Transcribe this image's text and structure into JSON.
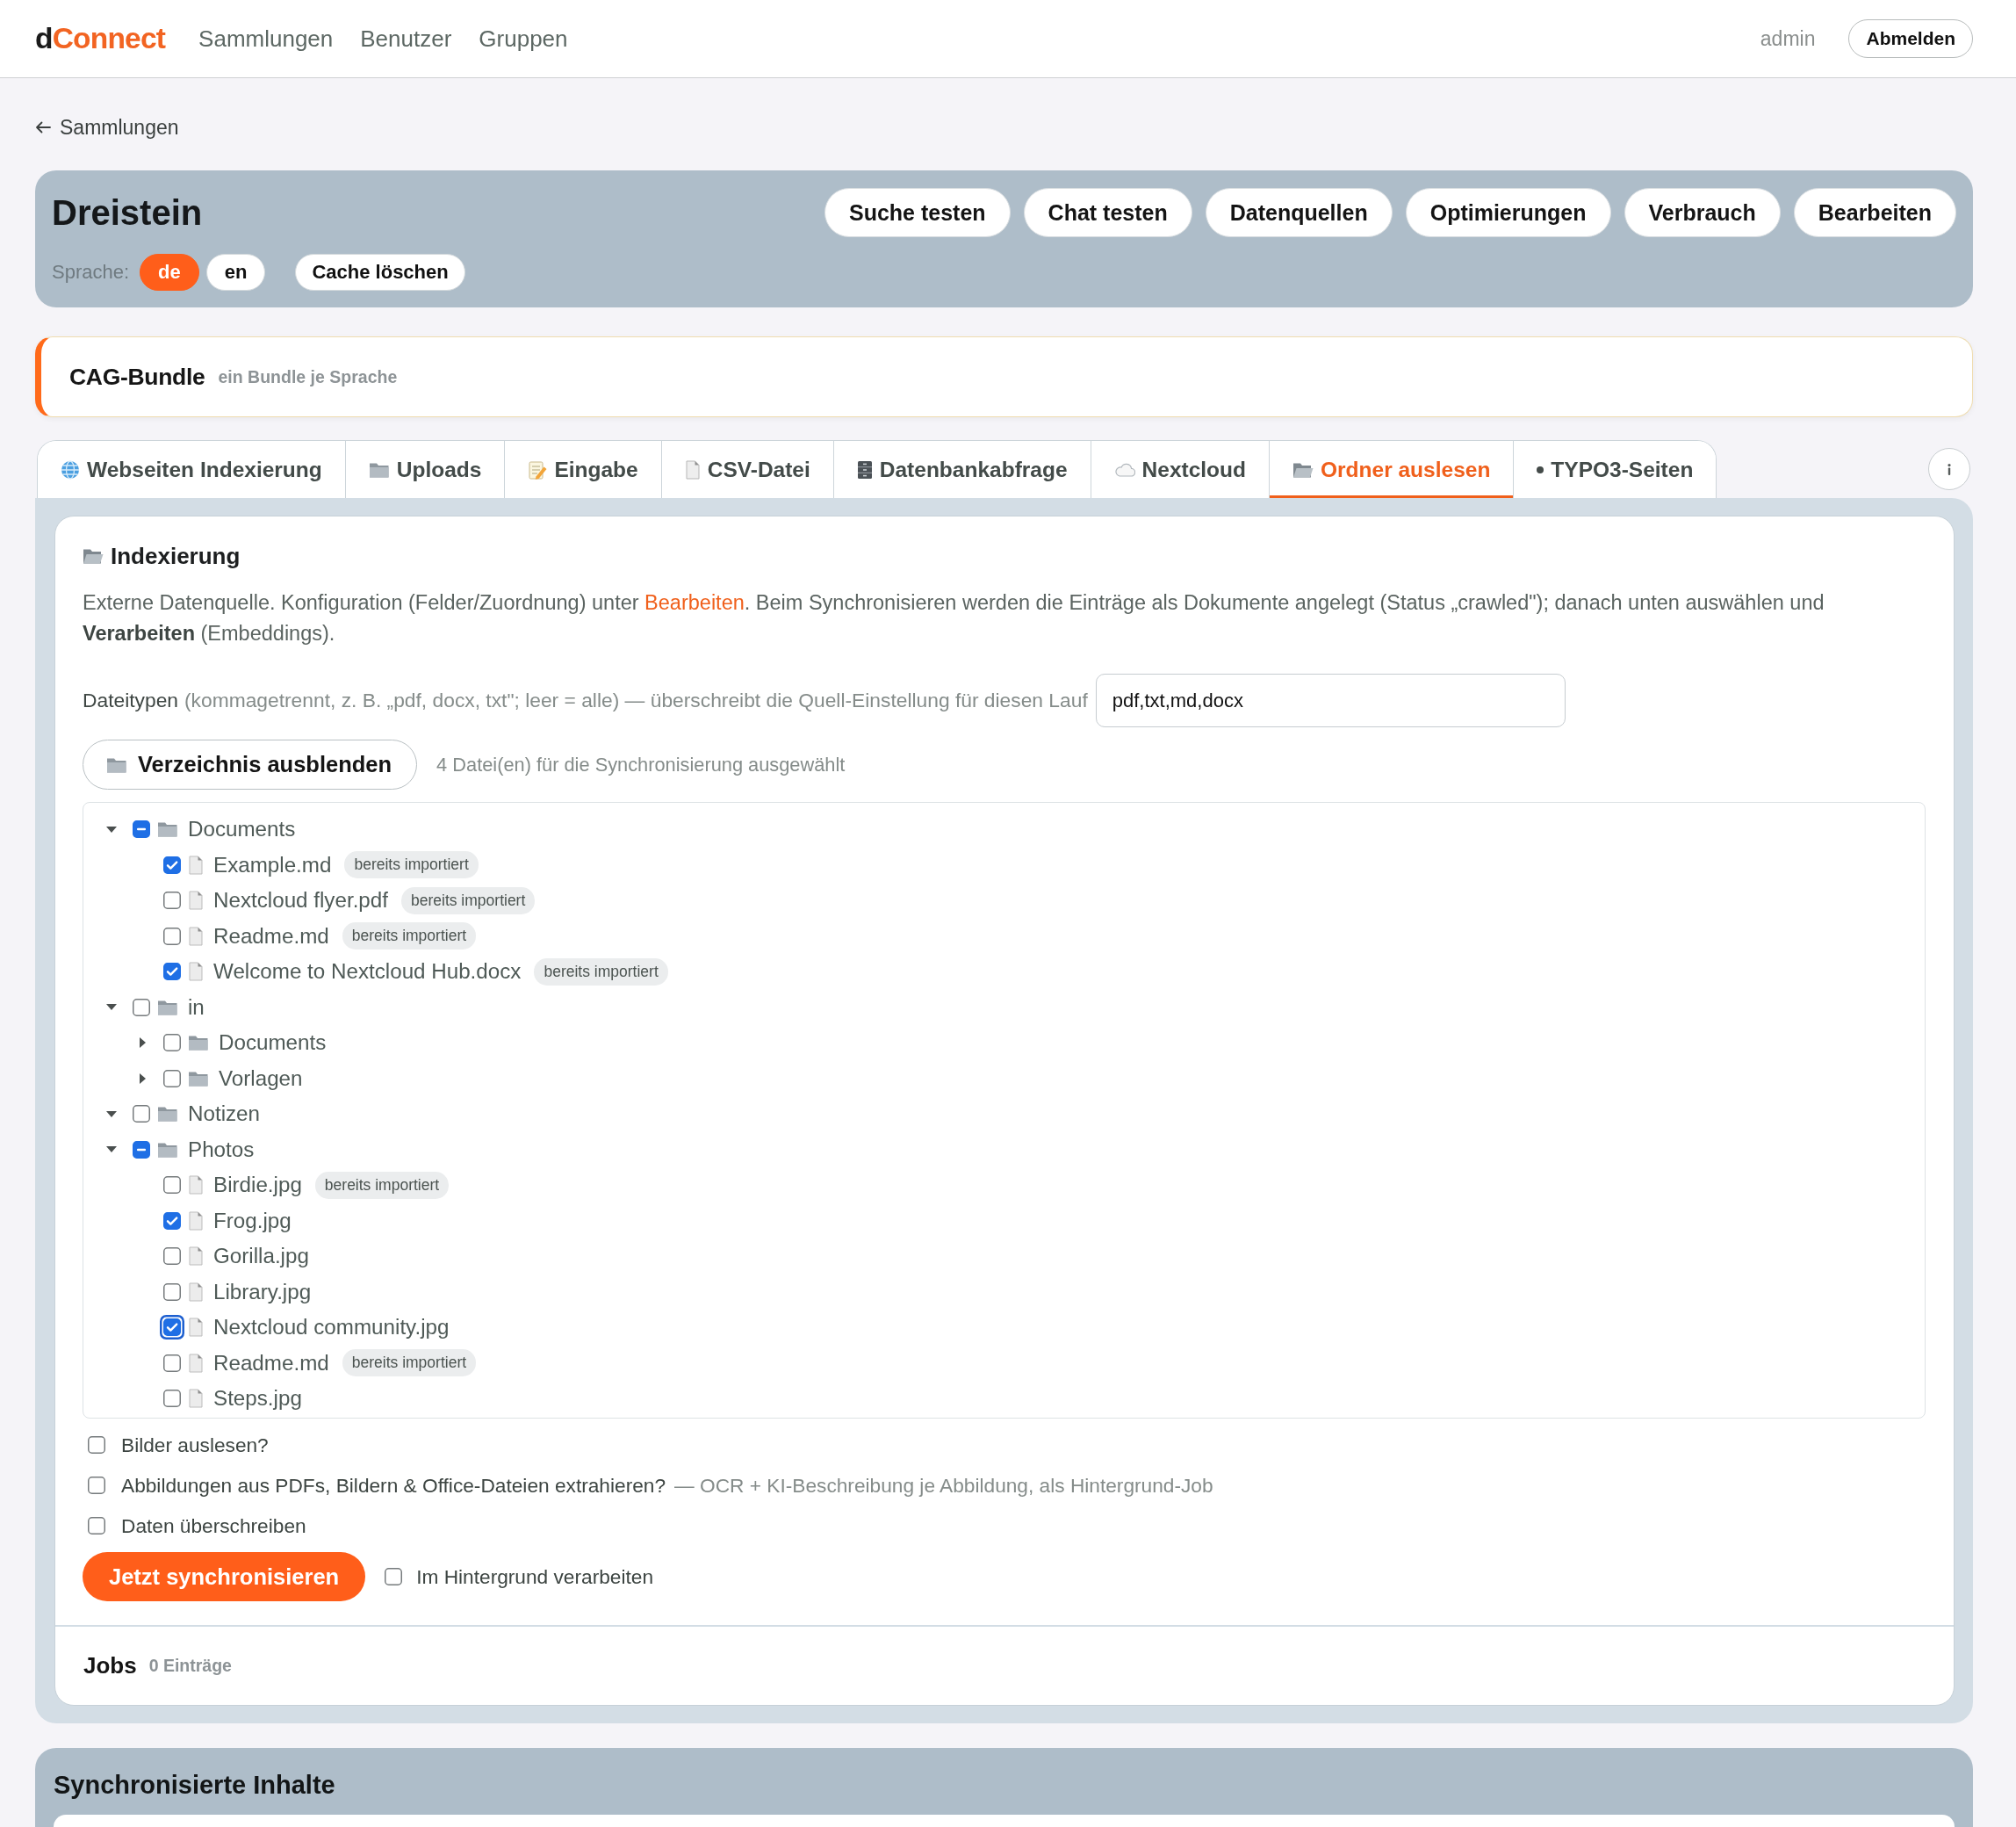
{
  "top_bar": {
    "logo": {
      "lead": "d",
      "accent": "Connect"
    },
    "nav": [
      "Sammlungen",
      "Benutzer",
      "Gruppen"
    ],
    "user": "admin",
    "logout": "Abmelden"
  },
  "back_link": "Sammlungen",
  "collection": {
    "title": "Dreistein",
    "actions": [
      "Suche testen",
      "Chat testen",
      "Datenquellen",
      "Optimierungen",
      "Verbrauch",
      "Bearbeiten"
    ],
    "language_label": "Sprache:",
    "languages": [
      {
        "label": "de",
        "selected": true
      },
      {
        "label": "en",
        "selected": false
      }
    ],
    "clear_cache": "Cache löschen"
  },
  "bundle": {
    "title": "CAG-Bundle",
    "subtitle": "ein Bundle je Sprache"
  },
  "tabs": [
    {
      "label": "Webseiten Indexierung",
      "selected": false
    },
    {
      "label": "Uploads",
      "selected": false
    },
    {
      "label": "Eingabe",
      "selected": false
    },
    {
      "label": "CSV-Datei",
      "selected": false
    },
    {
      "label": "Datenbankabfrage",
      "selected": false
    },
    {
      "label": "Nextcloud",
      "selected": false
    },
    {
      "label": "Ordner auslesen",
      "selected": true
    },
    {
      "label": "TYPO3-Seiten",
      "selected": false
    }
  ],
  "indexing": {
    "title": "Indexierung",
    "description": {
      "before": "Externe Datenquelle. Konfiguration (Felder/Zuordnung) unter ",
      "link": "Bearbeiten",
      "after": ". Beim Synchronisieren werden die Einträge als Dokumente angelegt (Status „crawled\"); danach unten auswählen und **Verarbeiten** (Embeddings)."
    },
    "file_types": {
      "label": "Dateitypen",
      "hint": "(kommagetrennt, z. B. „pdf, docx, txt\"; leer = alle) — überschreibt die Quell-Einstellung für diesen Lauf",
      "value": "pdf,txt,md,docx"
    },
    "directory_button": "Verzeichnis ausblenden",
    "selection_count": "4 Datei(en) für die Synchronisierung ausgewählt",
    "tree": [
      {
        "kind": "folder",
        "name": "Documents",
        "expanded": true,
        "checked": false,
        "indeterminate": true,
        "focused": false,
        "children": [
          {
            "kind": "file",
            "name": "Example.md",
            "checked": true,
            "focused": false,
            "badge": "bereits importiert"
          },
          {
            "kind": "file",
            "name": "Nextcloud flyer.pdf",
            "checked": false,
            "focused": false,
            "badge": "bereits importiert"
          },
          {
            "kind": "file",
            "name": "Readme.md",
            "checked": false,
            "focused": false,
            "badge": "bereits importiert"
          },
          {
            "kind": "file",
            "name": "Welcome to Nextcloud Hub.docx",
            "checked": true,
            "focused": false,
            "badge": "bereits importiert"
          }
        ]
      },
      {
        "kind": "folder",
        "name": "in",
        "expanded": true,
        "checked": false,
        "indeterminate": false,
        "focused": false,
        "children": [
          {
            "kind": "folder",
            "name": "Documents",
            "expanded": false,
            "checked": false,
            "indeterminate": false,
            "focused": false
          },
          {
            "kind": "folder",
            "name": "Vorlagen",
            "expanded": false,
            "checked": false,
            "indeterminate": false,
            "focused": false
          }
        ]
      },
      {
        "kind": "folder",
        "name": "Notizen",
        "expanded": true,
        "checked": false,
        "indeterminate": false,
        "focused": false
      },
      {
        "kind": "folder",
        "name": "Photos",
        "expanded": true,
        "checked": false,
        "indeterminate": true,
        "focused": false,
        "children": [
          {
            "kind": "file",
            "name": "Birdie.jpg",
            "checked": false,
            "focused": false,
            "badge": "bereits importiert"
          },
          {
            "kind": "file",
            "name": "Frog.jpg",
            "checked": true,
            "focused": false
          },
          {
            "kind": "file",
            "name": "Gorilla.jpg",
            "checked": false,
            "focused": false
          },
          {
            "kind": "file",
            "name": "Library.jpg",
            "checked": false,
            "focused": false
          },
          {
            "kind": "file",
            "name": "Nextcloud community.jpg",
            "checked": true,
            "focused": true
          },
          {
            "kind": "file",
            "name": "Readme.md",
            "checked": false,
            "focused": false,
            "badge": "bereits importiert"
          },
          {
            "kind": "file",
            "name": "Steps.jpg",
            "checked": false,
            "focused": false
          }
        ]
      }
    ],
    "options": [
      {
        "label": "Bilder auslesen?",
        "checked": false
      },
      {
        "label": "Abbildungen aus PDFs, Bildern & Office-Dateien extrahieren?",
        "hint": "— OCR + KI-Beschreibung je Abbildung, als Hintergrund-Job",
        "checked": false
      },
      {
        "label": "Daten überschreiben",
        "checked": false
      }
    ],
    "sync_button": "Jetzt synchronisieren",
    "background": {
      "label": "Im Hintergrund verarbeiten",
      "checked": false
    }
  },
  "jobs": {
    "title": "Jobs",
    "count": "0 Einträge"
  },
  "synced": {
    "title": "Synchronisierte Inhalte"
  }
}
